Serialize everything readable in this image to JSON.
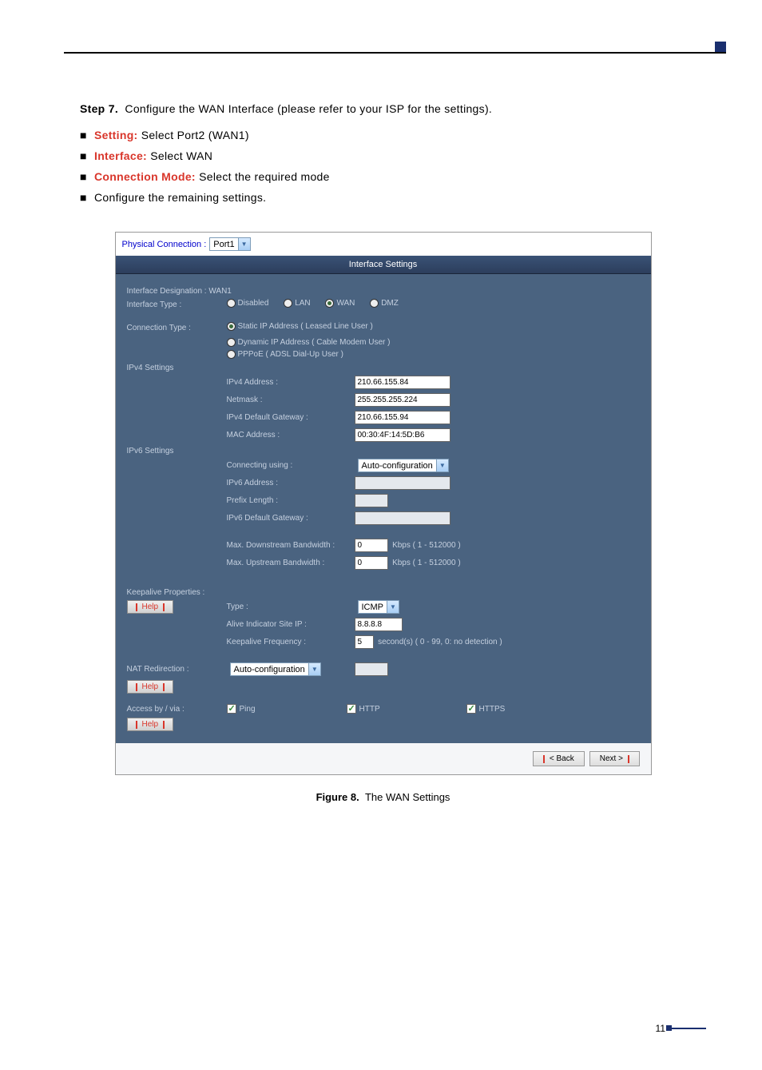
{
  "page": {
    "step_title": "Step 7.",
    "step_text": "Configure the WAN Interface (please refer to your ISP for the settings).",
    "bullets": [
      {
        "bold": "Setting:",
        "text": " Select Port2 (WAN1)",
        "red": true
      },
      {
        "bold": "Interface:",
        "text": " Select WAN",
        "red": true
      },
      {
        "bold": "Connection Mode:",
        "text": " Select the required mode",
        "red": true
      },
      {
        "bold": "",
        "text": "Configure the remaining settings.",
        "red": false
      }
    ],
    "figure_num": "Figure 8.",
    "figure_caption": "The WAN Settings",
    "page_number": "11"
  },
  "ui": {
    "phys_conn_label": "Physical Connection :",
    "phys_conn_value": "Port1",
    "header": "Interface Settings",
    "designation_label": "Interface Designation : WAN1",
    "iftype_label": "Interface Type :",
    "iftype_opts": [
      "Disabled",
      "LAN",
      "WAN",
      "DMZ"
    ],
    "conntype_label": "Connection Type :",
    "conntype_opts": [
      "Static IP Address ( Leased Line User )",
      "Dynamic IP Address ( Cable Modem User )",
      "PPPoE ( ADSL Dial-Up User )"
    ],
    "ipv4_label": "IPv4 Settings",
    "ipv4": {
      "addr_label": "IPv4 Address :",
      "addr_val": "210.66.155.84",
      "mask_label": "Netmask :",
      "mask_val": "255.255.255.224",
      "gw_label": "IPv4 Default Gateway :",
      "gw_val": "210.66.155.94",
      "mac_label": "MAC Address :",
      "mac_val": "00:30:4F:14:5D:B6"
    },
    "ipv6_label": "IPv6 Settings",
    "ipv6": {
      "conn_label": "Connecting using :",
      "conn_val": "Auto-configuration",
      "addr_label": "IPv6 Address :",
      "prefix_label": "Prefix Length :",
      "gw_label": "IPv6 Default Gateway :"
    },
    "bw": {
      "down_label": "Max. Downstream Bandwidth :",
      "down_val": "0",
      "unit": "Kbps ( 1 - 512000 )",
      "up_label": "Max. Upstream Bandwidth :",
      "up_val": "0"
    },
    "keepalive_label": "Keepalive Properties :",
    "keepalive": {
      "type_label": "Type :",
      "type_val": "ICMP",
      "ip_label": "Alive Indicator Site IP :",
      "ip_val": "8.8.8.8",
      "freq_label": "Keepalive Frequency :",
      "freq_val": "5",
      "freq_unit": "second(s)  ( 0 - 99, 0: no detection )"
    },
    "nat_label": "NAT Redirection :",
    "nat_val": "Auto-configuration",
    "access_label": "Access by / via :",
    "access": {
      "ping": "Ping",
      "http": "HTTP",
      "https": "HTTPS"
    },
    "help": "Help",
    "back": "< Back",
    "next": "Next >"
  }
}
